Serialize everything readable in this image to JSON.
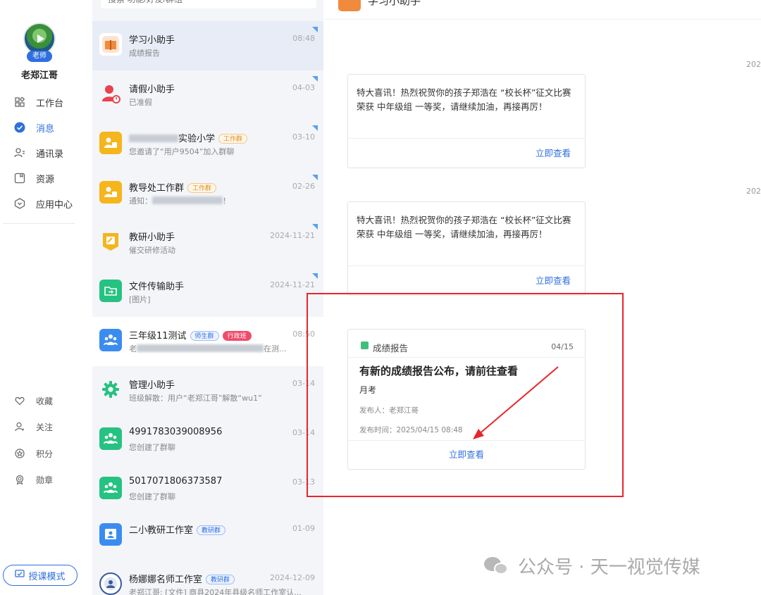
{
  "leftnav": {
    "role_badge": "老师",
    "username": "老郑江哥",
    "items": [
      {
        "label": "工作台",
        "icon": "workbench-icon"
      },
      {
        "label": "消息",
        "icon": "message-icon"
      },
      {
        "label": "通讯录",
        "icon": "contacts-icon"
      },
      {
        "label": "资源",
        "icon": "resource-icon"
      },
      {
        "label": "应用中心",
        "icon": "app-center-icon"
      }
    ],
    "sub_items": [
      {
        "label": "收藏",
        "icon": "heart-icon"
      },
      {
        "label": "关注",
        "icon": "follow-icon"
      },
      {
        "label": "积分",
        "icon": "points-icon"
      },
      {
        "label": "勋章",
        "icon": "medal-icon"
      }
    ],
    "teach_mode": "授课模式"
  },
  "search": {
    "placeholder": "搜索 功能/好友/群组"
  },
  "conversations": [
    {
      "name": "学习小助手",
      "preview": "成绩报告",
      "time": "08:48",
      "color": "#f08a3c"
    },
    {
      "name": "请假小助手",
      "preview": "已准假",
      "time": "04-03",
      "color": "#e8434e"
    },
    {
      "name_suffix": "实验小学",
      "tag": "工作群",
      "preview": "您邀请了“用户9504”加入群聊",
      "time": "03-10",
      "color": "#f5b51c"
    },
    {
      "name": "教导处工作群",
      "tag": "工作群",
      "preview_prefix": "通知：",
      "preview_suffix": "！",
      "time": "02-26",
      "color": "#f5b51c"
    },
    {
      "name": "教研小助手",
      "preview": "催交研修活动",
      "time": "2024-11-21",
      "color": "#f5b51c"
    },
    {
      "name": "文件传输助手",
      "preview": "[图片]",
      "time": "2024-11-21",
      "color": "#26c281"
    },
    {
      "name": "三年级11测试",
      "tag1": "师生群",
      "tag2": "行政班",
      "preview_prefix": "老",
      "preview_suffix": "在测...",
      "time": "08:50",
      "color": "#3b8cf0"
    },
    {
      "name": "管理小助手",
      "preview": "班级解散：用户“老郑江哥”解散“wu1”",
      "time": "03-14",
      "color": "#26c281"
    },
    {
      "name": "4991783039008956",
      "preview": "您创建了群聊",
      "time": "03-14",
      "color": "#26c281"
    },
    {
      "name": "5017071806373587",
      "preview": "您创建了群聊",
      "time": "03-13",
      "color": "#26c281"
    },
    {
      "name": "二小教研工作室",
      "tag": "教研群",
      "preview": "",
      "time": "01-09",
      "color": "#3b8cf0"
    },
    {
      "name": "杨娜娜名师工作室",
      "tag": "教研群",
      "preview": "老郑江哥: [文件] 商县2024年县级名师工作室认...",
      "time": "2024-12-09",
      "color": "#3a5a9a"
    }
  ],
  "chat": {
    "title": "学习小助手",
    "date_stamps": [
      "202",
      "202"
    ],
    "messages": [
      {
        "text": "特大喜讯！热烈祝贺你的孩子郑浩在 “校长杯”征文比赛 荣获 中年级组 一等奖，请继续加油，再接再厉！",
        "link": "立即查看"
      },
      {
        "text": "特大喜讯！热烈祝贺你的孩子郑浩在 “校长杯”征文比赛 荣获 中年级组 一等奖，请继续加油，再接再厉！",
        "link": "立即查看"
      }
    ],
    "report": {
      "type": "成绩报告",
      "date": "04/15",
      "title": "有新的成绩报告公布，请前往查看",
      "subtitle": "月考",
      "publisher": "发布人：老郑江哥",
      "publish_time": "发布时间：2025/04/15 08:48",
      "link": "立即查看"
    }
  },
  "watermark": "公众号 · 天一视觉传媒",
  "colors": {
    "accent": "#2f6fe0",
    "highlight": "#e8252b"
  }
}
